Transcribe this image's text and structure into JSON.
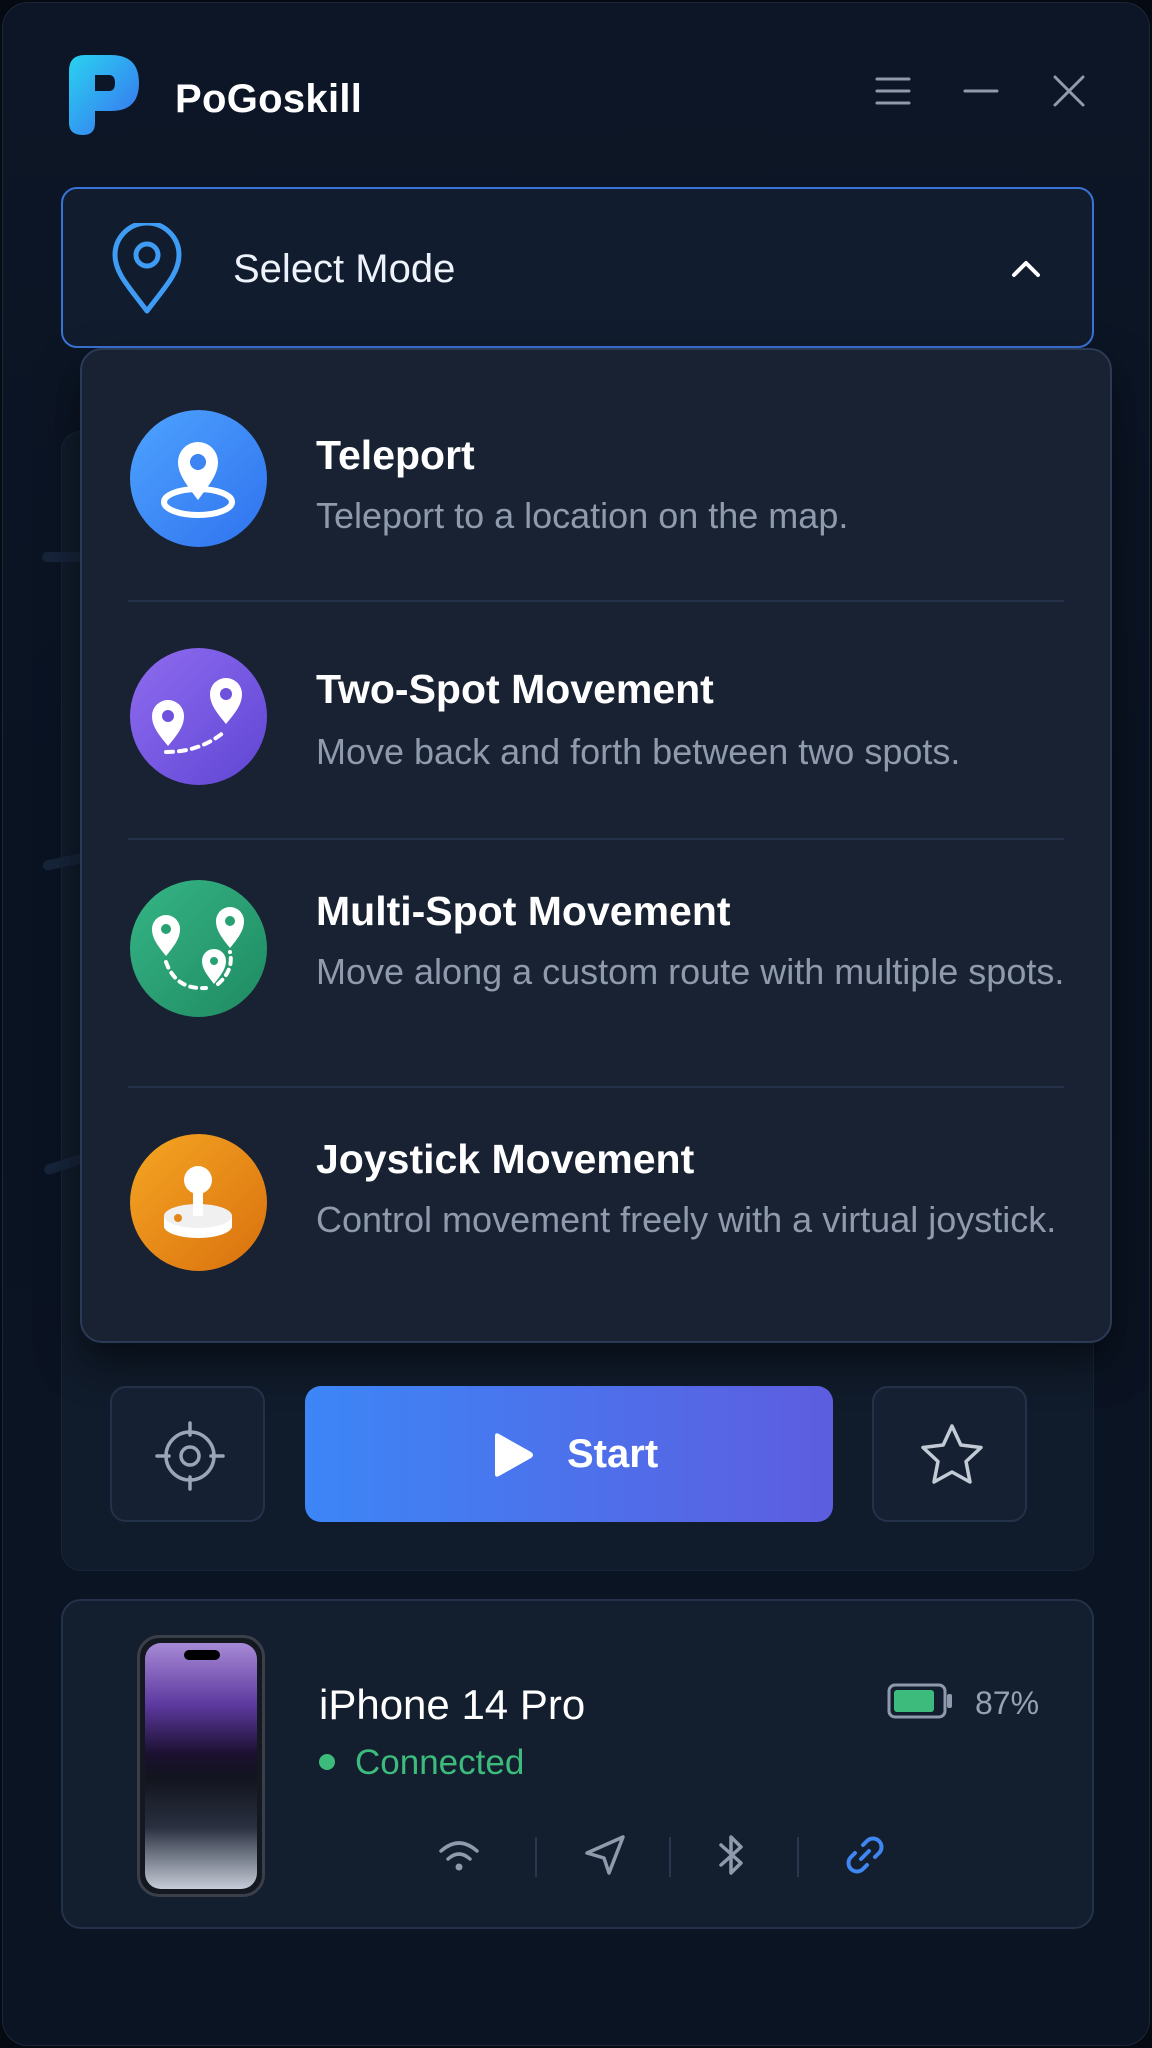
{
  "app": {
    "title": "PoGoskill"
  },
  "colors": {
    "accent": "#3c86f7",
    "connected": "#3dbb7c",
    "battery": "#3dbb7c"
  },
  "select_mode": {
    "label": "Select Mode",
    "icon": "map-pin-icon",
    "expanded": true
  },
  "modes": [
    {
      "title": "Teleport",
      "description": "Teleport to a location on the map.",
      "icon": "teleport-icon",
      "color": "#3a86f5"
    },
    {
      "title": "Two-Spot Movement",
      "description": "Move back and forth between two spots.",
      "icon": "two-spot-icon",
      "color": "#7b5de0"
    },
    {
      "title": "Multi-Spot Movement",
      "description": "Move along a custom route with multiple spots.",
      "icon": "multi-spot-icon",
      "color": "#23a070"
    },
    {
      "title": "Joystick Movement",
      "description": "Control movement freely with a virtual joystick.",
      "icon": "joystick-icon",
      "color": "#e88a16"
    }
  ],
  "actions": {
    "locate_icon": "crosshair-icon",
    "start_label": "Start",
    "favorite_icon": "star-icon"
  },
  "device": {
    "name": "iPhone 14 Pro",
    "status": "Connected",
    "battery_percent": "87%",
    "battery_level": 0.87,
    "connections": [
      "wifi-icon",
      "location-arrow-icon",
      "bluetooth-icon",
      "link-icon"
    ]
  }
}
